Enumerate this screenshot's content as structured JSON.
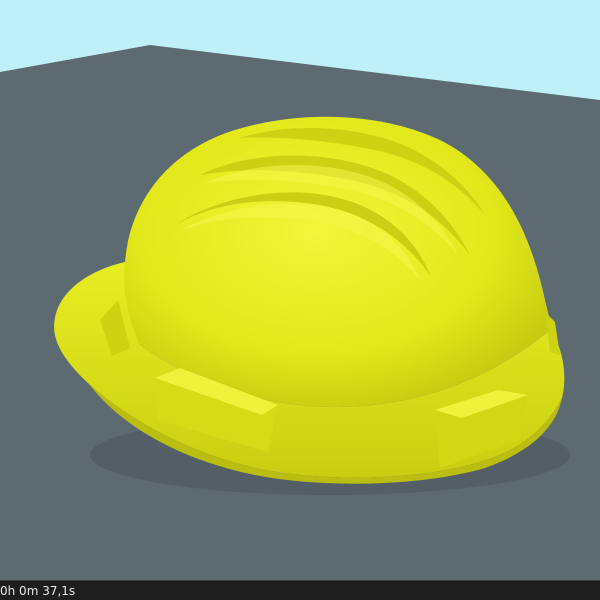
{
  "status": {
    "render_time": "0h 0m 37,1s"
  },
  "scene": {
    "sky_color": "#bff0f7",
    "ground_color": "#5e6a72",
    "helmet_color": "#e2e81a",
    "helmet_highlight": "#f2f53a",
    "helmet_shadow": "#b6bb0c"
  }
}
